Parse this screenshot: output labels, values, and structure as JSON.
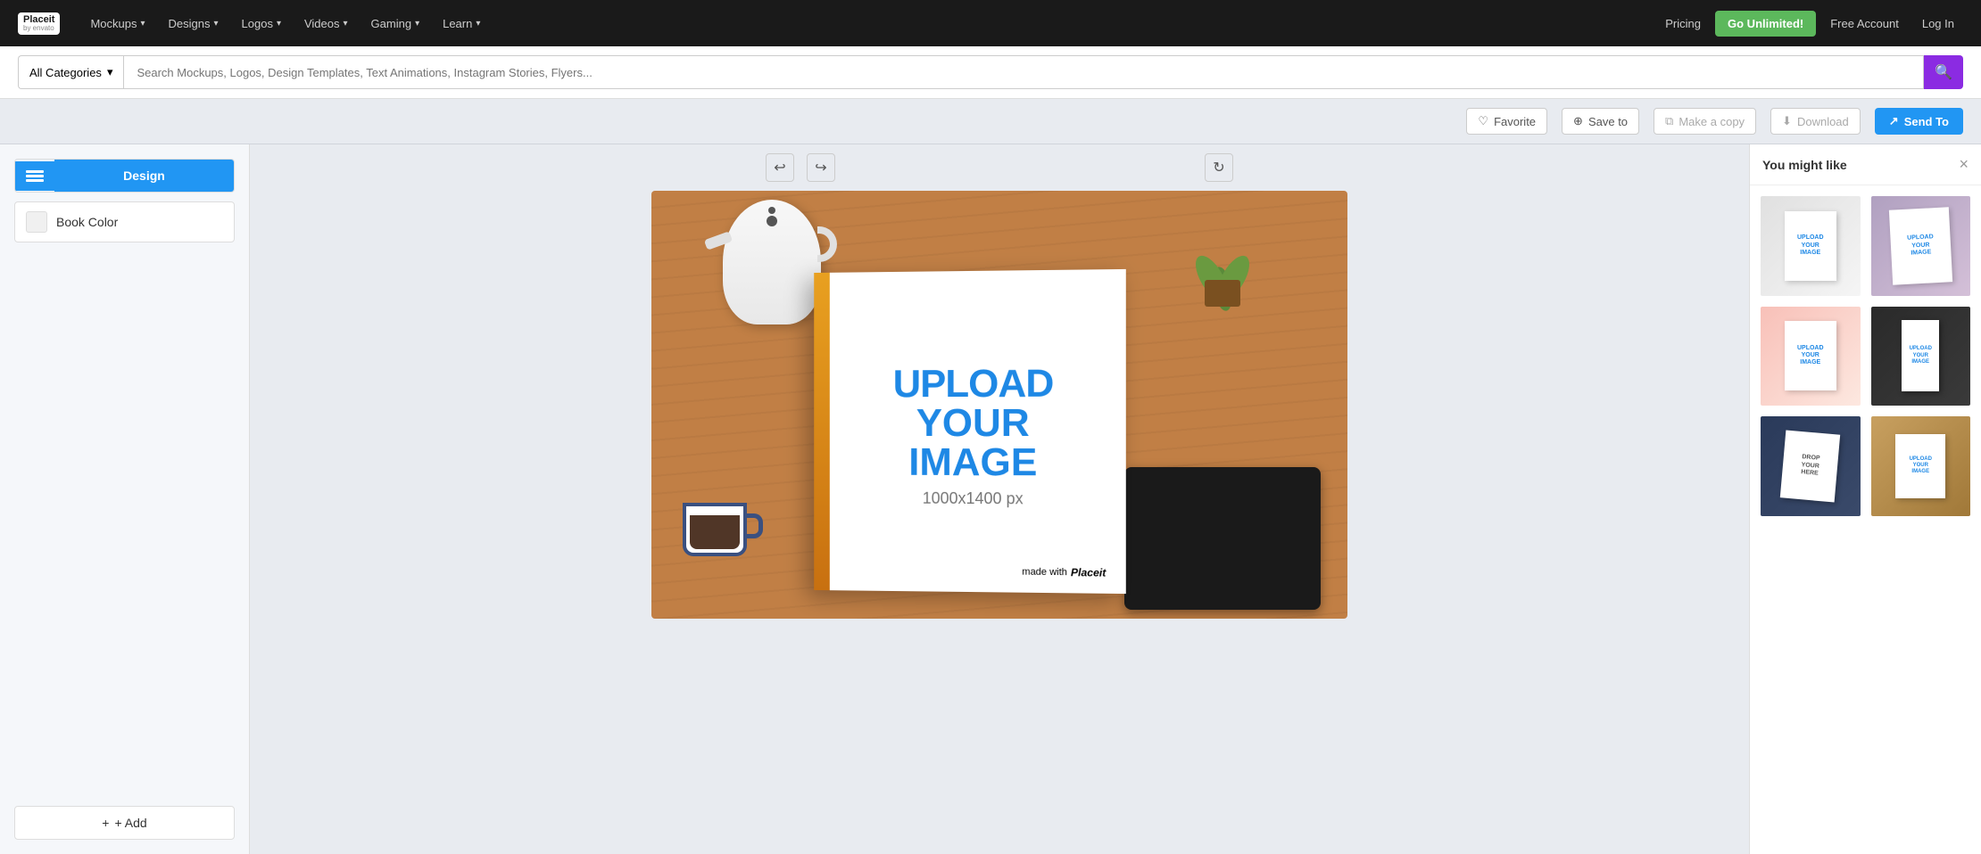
{
  "nav": {
    "logo_text": "Placeit",
    "logo_sub": "by envato",
    "items": [
      {
        "label": "Mockups",
        "id": "mockups"
      },
      {
        "label": "Designs",
        "id": "designs"
      },
      {
        "label": "Logos",
        "id": "logos"
      },
      {
        "label": "Videos",
        "id": "videos"
      },
      {
        "label": "Gaming",
        "id": "gaming"
      },
      {
        "label": "Learn",
        "id": "learn"
      }
    ],
    "pricing": "Pricing",
    "go_unlimited": "Go Unlimited!",
    "free_account": "Free Account",
    "login": "Log In"
  },
  "search": {
    "category": "All Categories",
    "placeholder": "Search Mockups, Logos, Design Templates, Text Animations, Instagram Stories, Flyers..."
  },
  "actions": {
    "favorite": "Favorite",
    "save_to": "Save to",
    "make_copy": "Make a copy",
    "download": "Download",
    "send_to": "Send To"
  },
  "left_panel": {
    "design_label": "Design",
    "book_color": "Book Color",
    "add_label": "+ Add"
  },
  "canvas": {
    "mockup_text_line1": "UPLOAD",
    "mockup_text_line2": "YOUR",
    "mockup_text_line3": "IMAGE",
    "mockup_dimensions": "1000x1400 px",
    "made_with": "made with",
    "placeit": "Placeit"
  },
  "right_panel": {
    "title": "You might like",
    "thumbnails": [
      {
        "id": "thumb-1",
        "bg": "gray"
      },
      {
        "id": "thumb-2",
        "bg": "lavender"
      },
      {
        "id": "thumb-3",
        "bg": "pink"
      },
      {
        "id": "thumb-4",
        "bg": "dark"
      },
      {
        "id": "thumb-5",
        "bg": "blue-dark"
      },
      {
        "id": "thumb-6",
        "bg": "wood"
      }
    ]
  }
}
